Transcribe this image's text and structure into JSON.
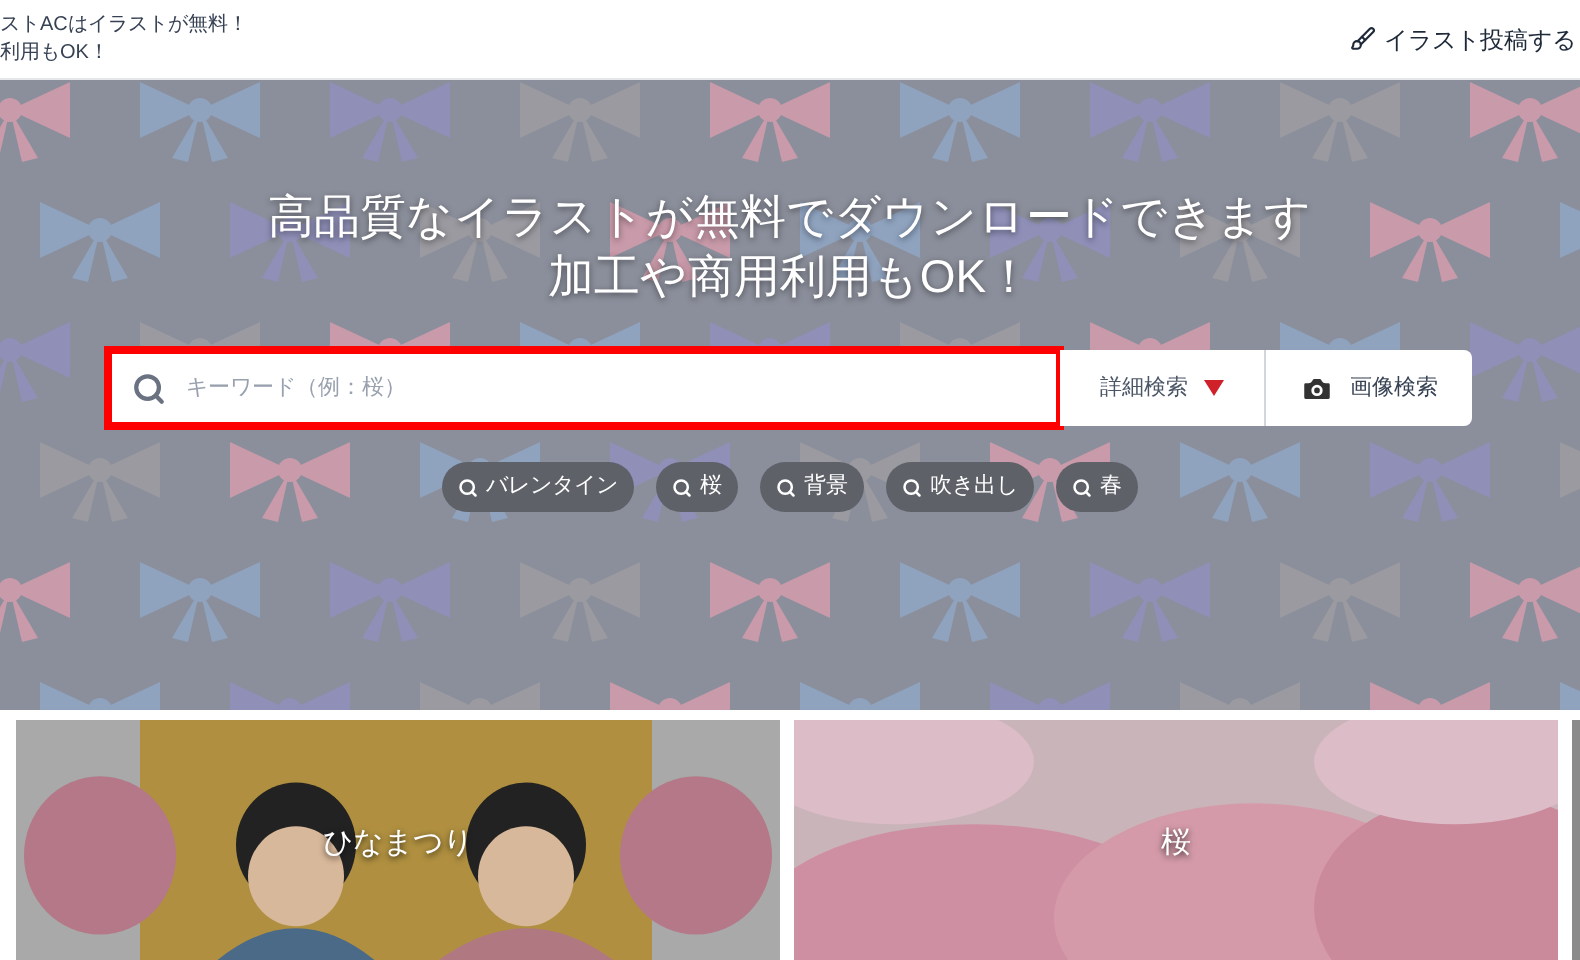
{
  "header": {
    "tagline": [
      "ストACはイラストが無料！",
      "利用もOK！"
    ],
    "post_link": "イラスト投稿する"
  },
  "hero": {
    "headline": [
      "高品質なイラストが無料でダウンロードできます",
      "加工や商用利用もOK！"
    ],
    "search": {
      "placeholder": "キーワード（例：桜）",
      "highlighted": true
    },
    "detail_search": "詳細検索",
    "image_search": "画像検索",
    "tags": [
      "バレンタイン",
      "桜",
      "背景",
      "吹き出し",
      "春"
    ]
  },
  "cards": [
    {
      "label": "ひなまつり",
      "kind": "dolls"
    },
    {
      "label": "桜",
      "kind": "blossoms"
    }
  ]
}
